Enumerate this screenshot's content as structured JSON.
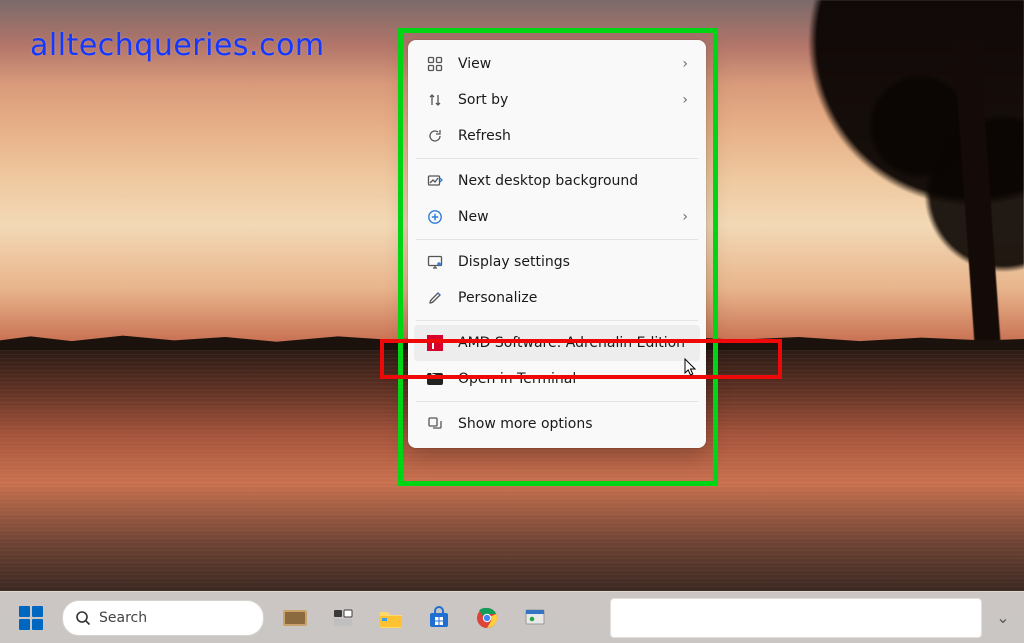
{
  "watermark": "alltechqueries.com",
  "context_menu": {
    "groups": [
      [
        {
          "id": "view",
          "label": "View",
          "has_submenu": true
        },
        {
          "id": "sortby",
          "label": "Sort by",
          "has_submenu": true
        },
        {
          "id": "refresh",
          "label": "Refresh",
          "has_submenu": false
        }
      ],
      [
        {
          "id": "next_bg",
          "label": "Next desktop background",
          "has_submenu": false
        },
        {
          "id": "new",
          "label": "New",
          "has_submenu": true
        }
      ],
      [
        {
          "id": "display",
          "label": "Display settings",
          "has_submenu": false
        },
        {
          "id": "personalize",
          "label": "Personalize",
          "has_submenu": false
        }
      ],
      [
        {
          "id": "amd",
          "label": "AMD Software: Adrenalin Edition",
          "has_submenu": false,
          "hovered": true
        },
        {
          "id": "terminal",
          "label": "Open in Terminal",
          "has_submenu": false
        }
      ],
      [
        {
          "id": "more",
          "label": "Show more options",
          "has_submenu": false
        }
      ]
    ]
  },
  "taskbar": {
    "search_placeholder": "Search"
  },
  "annotations": {
    "green_box": "context-menu-highlight",
    "red_box": "amd-menu-item-highlight"
  }
}
